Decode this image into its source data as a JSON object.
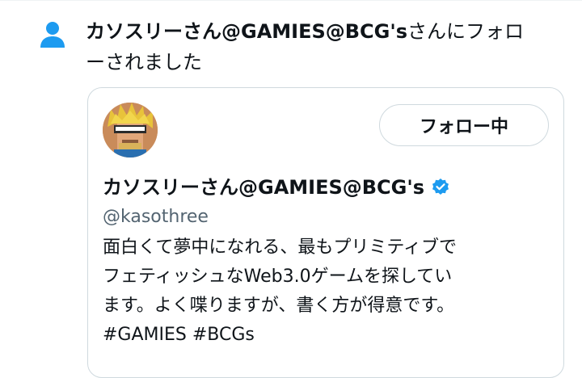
{
  "notification": {
    "icon": "person-icon",
    "name": "カソスリーさん@GAMIES@BCG's",
    "action_line1_suffix": "さんにフォロ",
    "action_line2": "ーされました"
  },
  "card": {
    "follow_button_label": "フォロー中",
    "display_name": "カソスリーさん@GAMIES@BCG's",
    "verified_icon": "verified-badge-icon",
    "handle": "@kasothree",
    "bio_lines": [
      "面白くて夢中になれる、最もプリミティブで",
      "フェティッシュなWeb3.0ゲームを探してい",
      "ます。よく喋りますが、書く方が得意です。"
    ],
    "hashtags": "#GAMIES #BCGs"
  },
  "colors": {
    "accent": "#1d9bf0",
    "text": "#0f1419",
    "secondary_text": "#536471",
    "border": "#cfd9de"
  }
}
